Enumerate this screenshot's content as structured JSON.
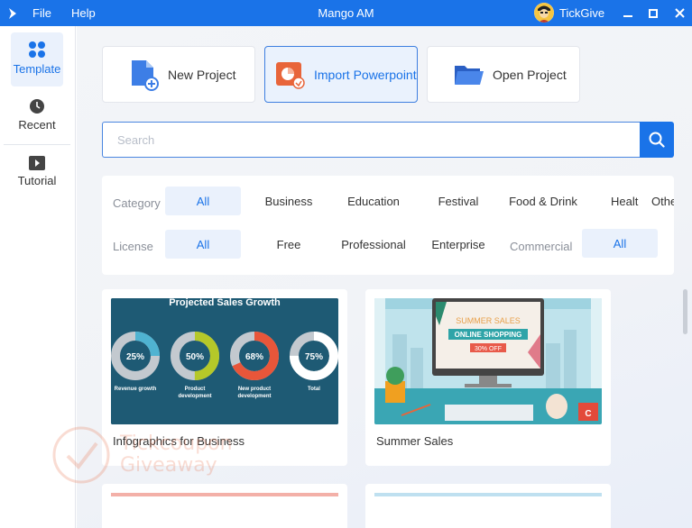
{
  "titlebar": {
    "menu": [
      "File",
      "Help"
    ],
    "app_title": "Mango AM",
    "username": "TickGive",
    "color": "#1a73e8"
  },
  "sidebar": {
    "items": [
      {
        "label": "Template",
        "icon": "template-grid-icon",
        "active": true
      },
      {
        "label": "Recent",
        "icon": "clock-icon",
        "active": false
      },
      {
        "label": "Tutorial",
        "icon": "play-icon",
        "active": false
      }
    ]
  },
  "actions": [
    {
      "label": "New Project",
      "icon": "new-file-icon"
    },
    {
      "label": "Import Powerpoint",
      "icon": "powerpoint-icon"
    },
    {
      "label": "Open Project",
      "icon": "folder-icon"
    }
  ],
  "search": {
    "placeholder": "Search"
  },
  "filters": {
    "category": {
      "label": "Category",
      "options": [
        "All",
        "Business",
        "Education",
        "Festival",
        "Food & Drink",
        "Healt",
        "Others"
      ],
      "selected": "All"
    },
    "license": {
      "label": "License",
      "options": [
        "All",
        "Free",
        "Professional",
        "Enterprise",
        "Commercial",
        "All"
      ],
      "selected": "All"
    }
  },
  "templates": [
    {
      "title": "Infographics for Business",
      "thumb": {
        "heading": "Projected Sales Growth",
        "donuts": [
          {
            "value": "25%",
            "label": "Revenue growth",
            "percent": 25,
            "color": "#4fb3d1"
          },
          {
            "value": "50%",
            "label": "Product development",
            "percent": 50,
            "color": "#b5c829"
          },
          {
            "value": "68%",
            "label": "New product development",
            "percent": 68,
            "color": "#e8563a"
          },
          {
            "value": "75%",
            "label": "Total",
            "percent": 75,
            "color": "#ffffff"
          }
        ]
      }
    },
    {
      "title": "Summer Sales",
      "thumb": {
        "line1": "SUMMER SALES",
        "line2": "ONLINE SHOPPING",
        "line3": "30% OFF",
        "badge": "C"
      }
    }
  ],
  "watermark": {
    "line1": "Tickcoupon",
    "line2": "Giveaway"
  }
}
